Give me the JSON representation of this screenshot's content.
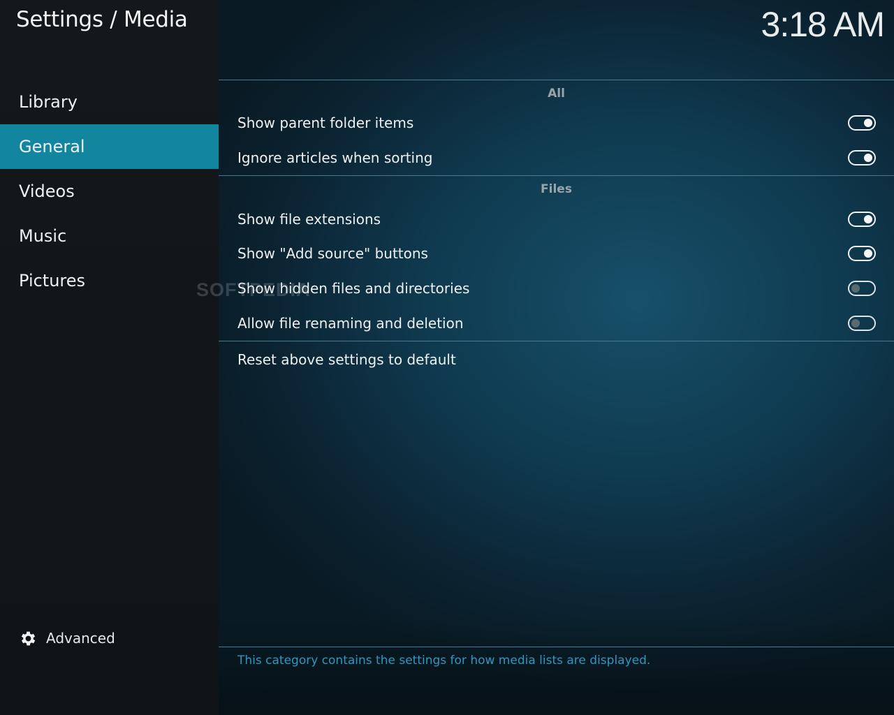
{
  "header": {
    "title": "Settings / Media",
    "clock": "3:18 AM"
  },
  "sidebar": {
    "items": [
      {
        "label": "Library",
        "active": false
      },
      {
        "label": "General",
        "active": true
      },
      {
        "label": "Videos",
        "active": false
      },
      {
        "label": "Music",
        "active": false
      },
      {
        "label": "Pictures",
        "active": false
      }
    ],
    "advanced": {
      "label": "Advanced",
      "icon": "gear-icon"
    }
  },
  "sections": {
    "all": {
      "header": "All",
      "rows": [
        {
          "label": "Show parent folder items",
          "enabled": true
        },
        {
          "label": "Ignore articles when sorting",
          "enabled": true
        }
      ]
    },
    "files": {
      "header": "Files",
      "rows": [
        {
          "label": "Show file extensions",
          "enabled": true
        },
        {
          "label": "Show \"Add source\" buttons",
          "enabled": true
        },
        {
          "label": "Show hidden files and directories",
          "enabled": false
        },
        {
          "label": "Allow file renaming and deletion",
          "enabled": false
        }
      ]
    }
  },
  "reset": {
    "label": "Reset above settings to default"
  },
  "description": "This category contains the settings for how media lists are displayed.",
  "watermark": "SOFTPEDIA",
  "colors": {
    "accent": "#12869f",
    "description_text": "#2f97c1",
    "sidebar_bg": "#14181b"
  }
}
